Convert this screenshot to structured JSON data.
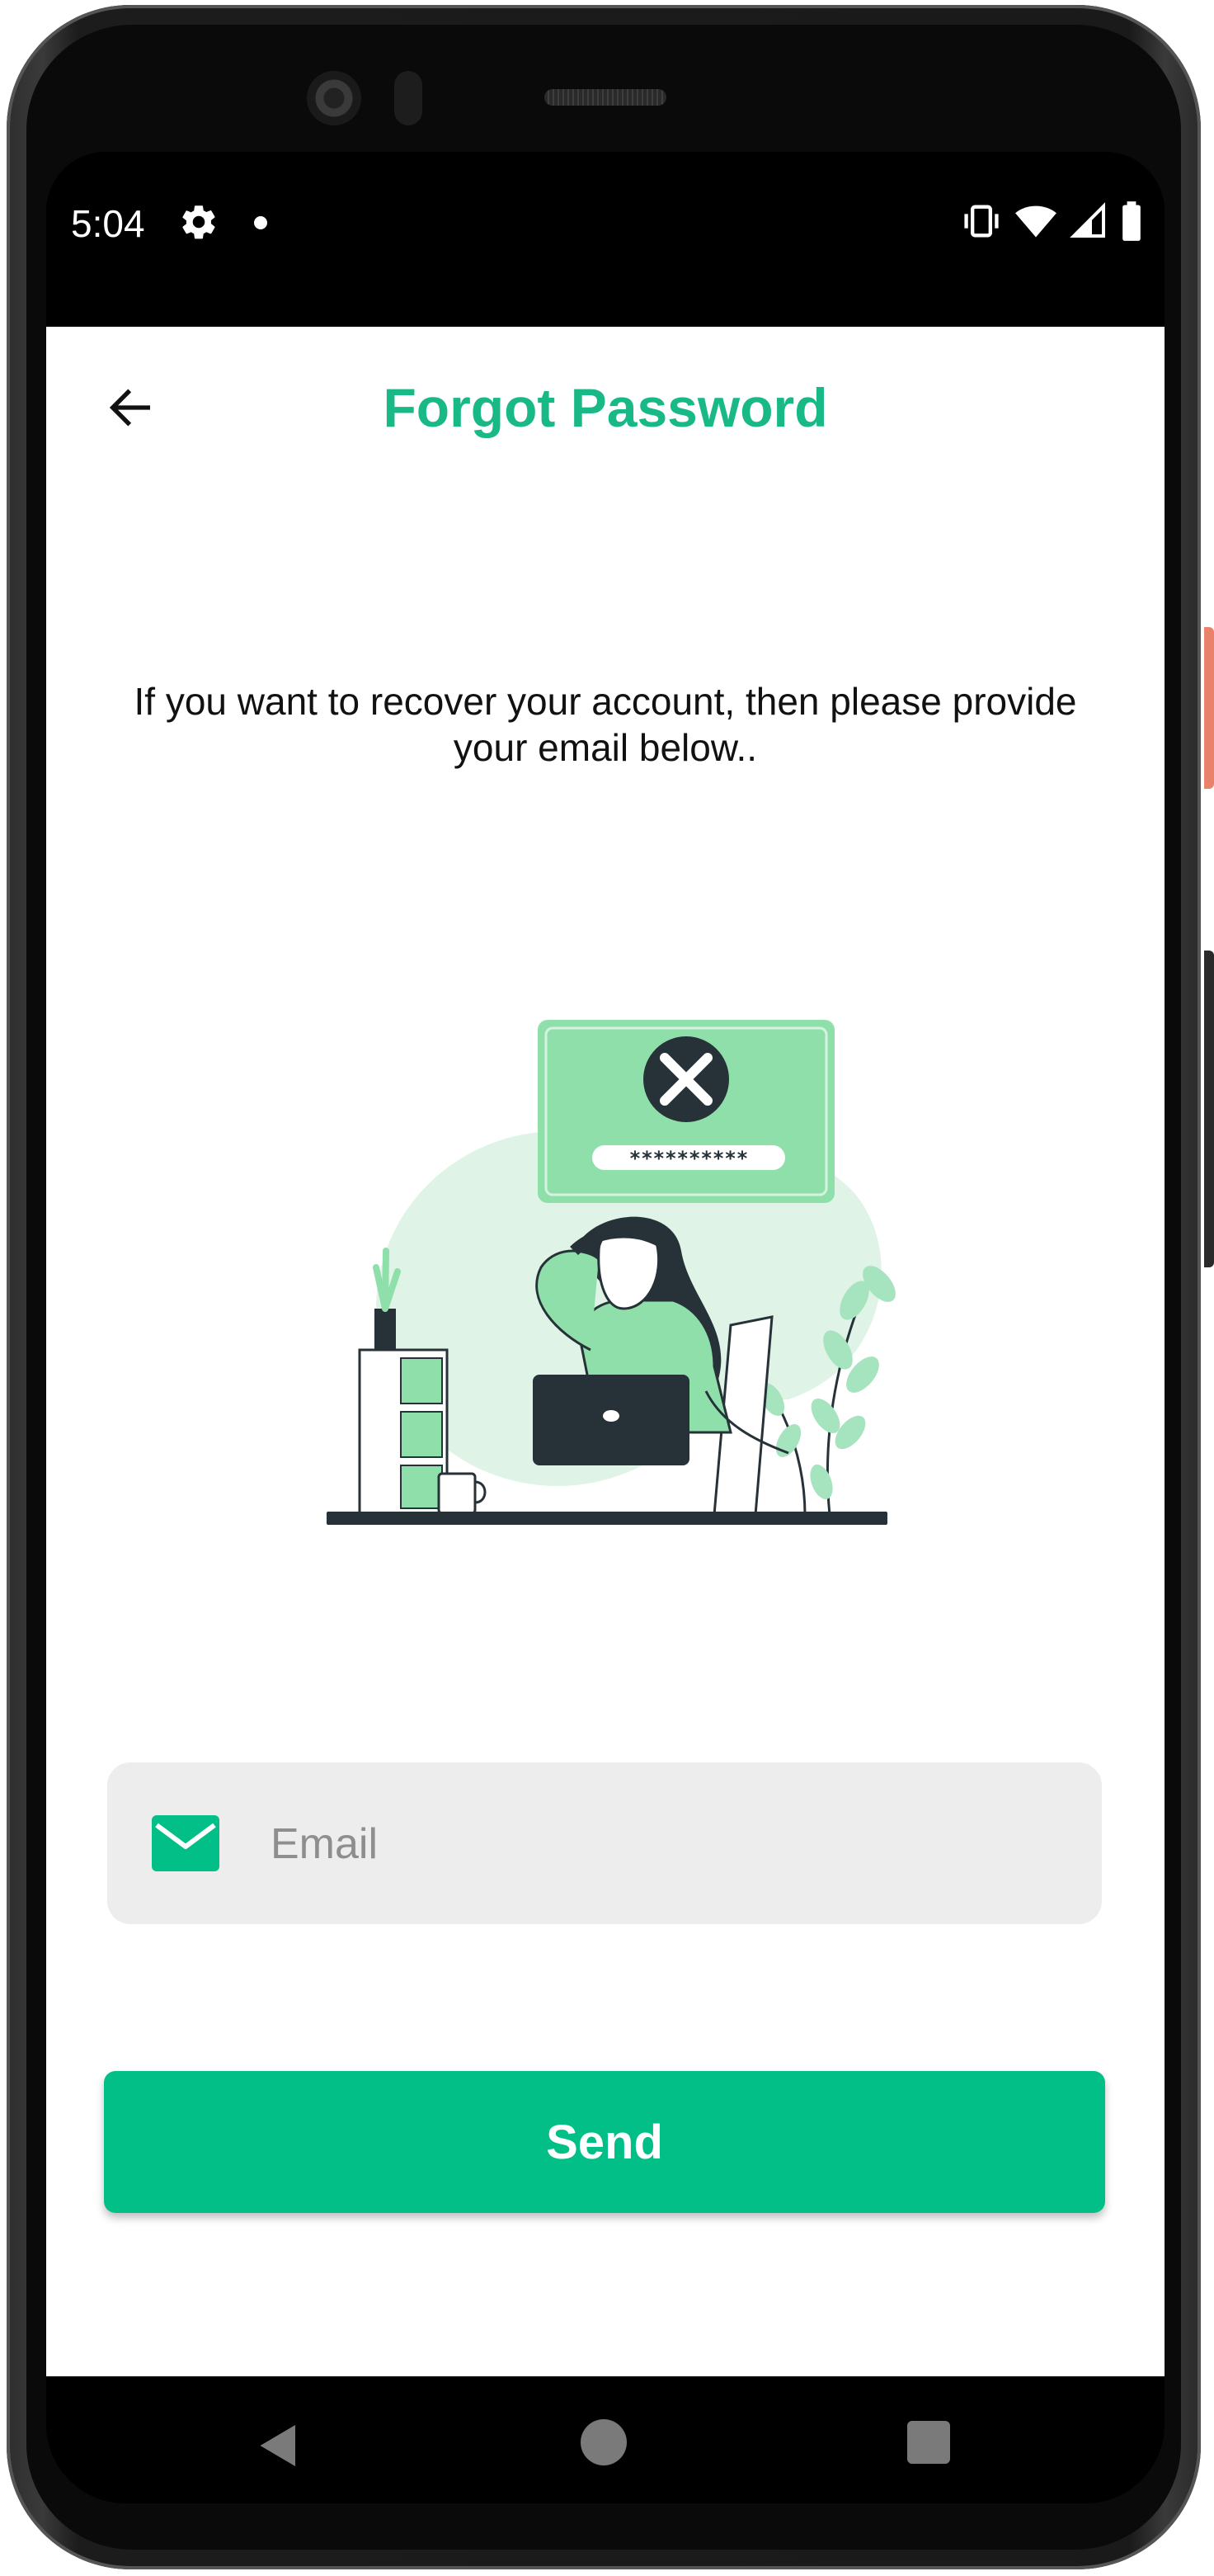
{
  "status_bar": {
    "time": "5:04",
    "left_icons": [
      "gear-icon",
      "notification-dot-icon"
    ],
    "right_icons": [
      "vibrate-icon",
      "wifi-icon",
      "signal-icon",
      "battery-icon"
    ]
  },
  "header": {
    "title": "Forgot Password",
    "back_icon": "arrow-left-icon"
  },
  "main": {
    "description": "If you want to recover your account, then please provide your email below..",
    "illustration": {
      "icon": "forgot-password-illustration",
      "password_mask": "**********"
    },
    "email": {
      "placeholder": "Email",
      "value": "",
      "icon": "mail-icon"
    },
    "send_label": "Send"
  },
  "nav_bar": {
    "icons": [
      "nav-back-icon",
      "nav-home-icon",
      "nav-recents-icon"
    ]
  },
  "colors": {
    "accent": "#02bf87",
    "title": "#19b987",
    "field_bg": "#ededed",
    "illustration_light": "#a6e3bf",
    "illustration_pale": "#dff4e6",
    "dark": "#263238"
  }
}
